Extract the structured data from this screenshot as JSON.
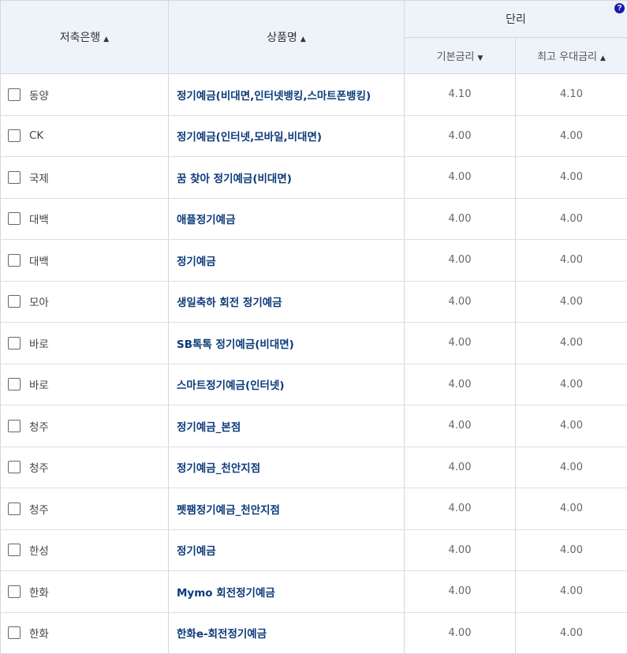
{
  "headers": {
    "bank": "저축은행",
    "product": "상품명",
    "group": "단리",
    "base_rate": "기본금리",
    "max_rate": "최고 우대금리",
    "help": "?"
  },
  "icons": {
    "bank_sort": "sort-up-icon",
    "product_sort": "sort-up-icon",
    "base_sort": "sort-down-icon",
    "max_sort": "sort-up-icon"
  },
  "rows": [
    {
      "bank": "동양",
      "product": "정기예금(비대면,인터넷뱅킹,스마트폰뱅킹)",
      "base": "4.10",
      "max": "4.10"
    },
    {
      "bank": "CK",
      "product": "정기예금(인터넷,모바일,비대면)",
      "base": "4.00",
      "max": "4.00"
    },
    {
      "bank": "국제",
      "product": "꿈 찾아 정기예금(비대면)",
      "base": "4.00",
      "max": "4.00"
    },
    {
      "bank": "대백",
      "product": "애플정기예금",
      "base": "4.00",
      "max": "4.00"
    },
    {
      "bank": "대백",
      "product": "정기예금",
      "base": "4.00",
      "max": "4.00"
    },
    {
      "bank": "모아",
      "product": "생일축하 회전 정기예금",
      "base": "4.00",
      "max": "4.00"
    },
    {
      "bank": "바로",
      "product": "SB톡톡 정기예금(비대면)",
      "base": "4.00",
      "max": "4.00"
    },
    {
      "bank": "바로",
      "product": "스마트정기예금(인터넷)",
      "base": "4.00",
      "max": "4.00"
    },
    {
      "bank": "청주",
      "product": "정기예금_본점",
      "base": "4.00",
      "max": "4.00"
    },
    {
      "bank": "청주",
      "product": "정기예금_천안지점",
      "base": "4.00",
      "max": "4.00"
    },
    {
      "bank": "청주",
      "product": "펫팸정기예금_천안지점",
      "base": "4.00",
      "max": "4.00"
    },
    {
      "bank": "한성",
      "product": "정기예금",
      "base": "4.00",
      "max": "4.00"
    },
    {
      "bank": "한화",
      "product": "Mymo 회전정기예금",
      "base": "4.00",
      "max": "4.00"
    },
    {
      "bank": "한화",
      "product": "한화e-회전정기예금",
      "base": "4.00",
      "max": "4.00"
    }
  ]
}
